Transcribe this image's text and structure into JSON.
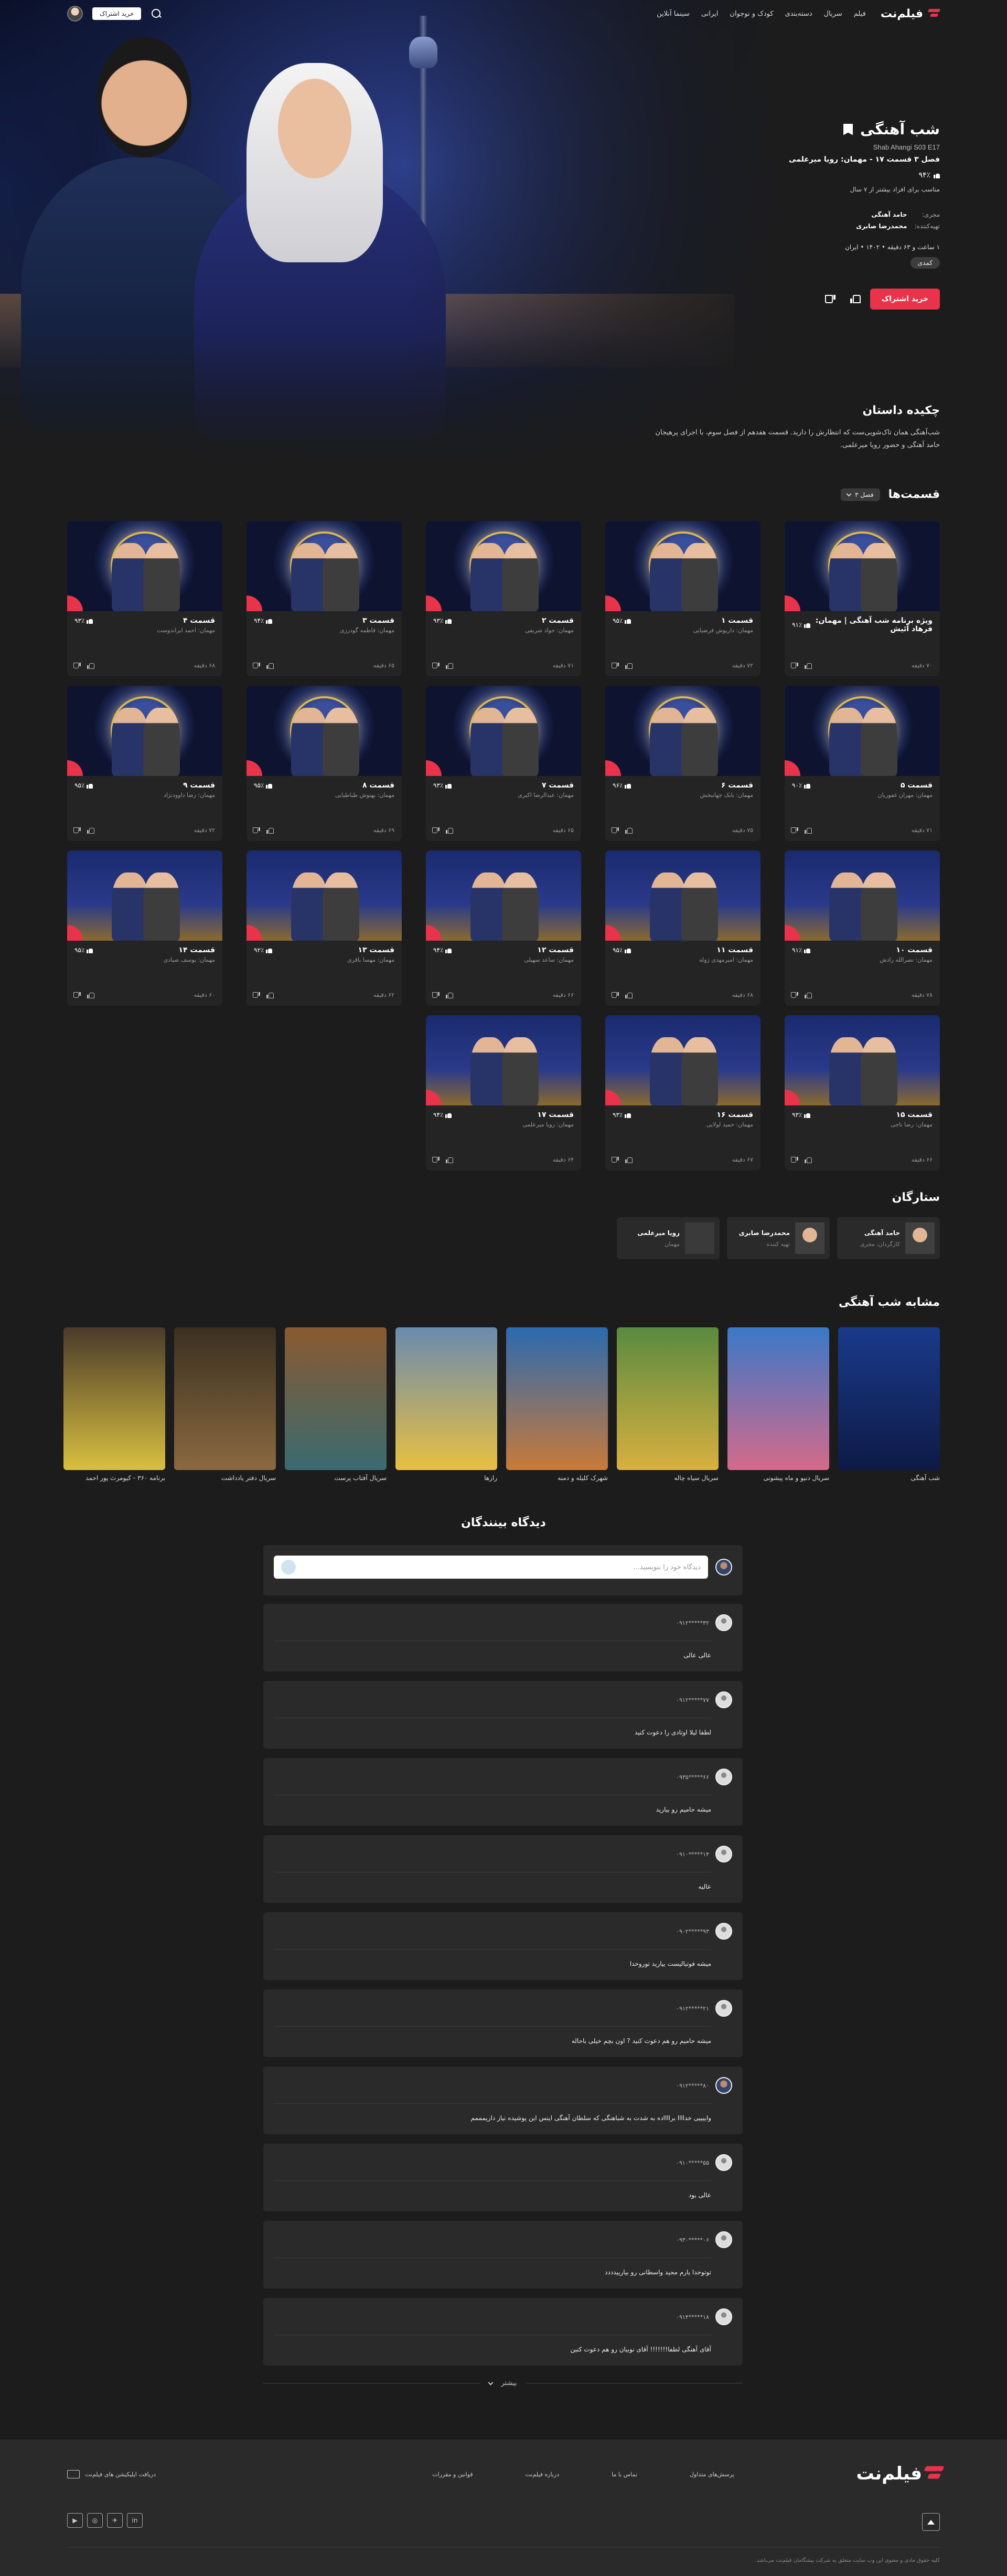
{
  "header": {
    "nav": [
      "فیلم",
      "سریال",
      "دسته‌بندی",
      "کودک و نوجوان",
      "ایرانی",
      "سینما آنلاین"
    ],
    "logo_text": "فیلم‌نت",
    "subscribe": "خرید اشتراک"
  },
  "hero": {
    "title": "شب آهنگی",
    "en_title": "Shab Ahangi S03 E17",
    "episode_title": "فصل ۳ قسمت ۱۷ - مهمان: رویا میرعلمی",
    "rating": "۹۴٪",
    "age": "مناسب برای افراد بیشتر از ۷ سال",
    "crew": [
      {
        "role": "مجری:",
        "name": "حامد آهنگی"
      },
      {
        "role": "تهیه‌کننده:",
        "name": "محمدرضا صابری"
      }
    ],
    "meta": "۱ ساعت و ۶۳ دقیقه  •  ۱۴۰۲  •  ایران",
    "genre": "کمدی",
    "subscribe_button": "خرید اشتراک"
  },
  "synopsis": {
    "title": "چکیده داستان",
    "text": "شب‌آهنگی همان تاک‌شویی‌ست که انتظارش را دارید. قسمت هفدهم از فصل سوم، با اجرای پرهیجان حامد آهنگی و حضور رویا میرعلمی."
  },
  "episodes_section": {
    "title": "قسمت‌ها",
    "season": "فصل ۳"
  },
  "episodes": [
    {
      "name": "ویژه برنامه شب آهنگی | مهمان: فرهاد آئیش",
      "guest": "",
      "rating": "۹۱٪",
      "duration": "۷۰ دقیقه",
      "city": false
    },
    {
      "name": "قسمت ۱",
      "guest": "مهمان: داریوش فرضیایی",
      "rating": "۹۵٪",
      "duration": "۷۲ دقیقه",
      "city": false
    },
    {
      "name": "قسمت ۲",
      "guest": "مهمان: جواد شریفی",
      "rating": "۹۳٪",
      "duration": "۷۱ دقیقه",
      "city": false
    },
    {
      "name": "قسمت ۳",
      "guest": "مهمان: فاطمه گودرزی",
      "rating": "۹۴٪",
      "duration": "۶۵ دقیقه",
      "city": false
    },
    {
      "name": "قسمت ۴",
      "guest": "مهمان: احمد ایراندوست",
      "rating": "۹۳٪",
      "duration": "۶۸ دقیقه",
      "city": false
    },
    {
      "name": "قسمت ۵",
      "guest": "مهمان: مهران غفوریان",
      "rating": "۹۰٪",
      "duration": "۷۱ دقیقه",
      "city": false
    },
    {
      "name": "قسمت ۶",
      "guest": "مهمان: بابک جهانبخش",
      "rating": "۹۶٪",
      "duration": "۷۵ دقیقه",
      "city": false
    },
    {
      "name": "قسمت ۷",
      "guest": "مهمان: عبدالرضا اکبری",
      "rating": "۹۳٪",
      "duration": "۶۵ دقیقه",
      "city": false
    },
    {
      "name": "قسمت ۸",
      "guest": "مهمان: بهنوش طباطبایی",
      "rating": "۹۵٪",
      "duration": "۶۹ دقیقه",
      "city": false
    },
    {
      "name": "قسمت ۹",
      "guest": "مهمان: رضا داوودنژاد",
      "rating": "۹۵٪",
      "duration": "۷۲ دقیقه",
      "city": false
    },
    {
      "name": "قسمت ۱۰",
      "guest": "مهمان: نصرالله رادش",
      "rating": "۹۱٪",
      "duration": "۷۸ دقیقه",
      "city": true
    },
    {
      "name": "قسمت ۱۱",
      "guest": "مهمان: امیرمهدی ژوله",
      "rating": "۹۵٪",
      "duration": "۶۸ دقیقه",
      "city": true
    },
    {
      "name": "قسمت ۱۲",
      "guest": "مهمان: ساعد سهیلی",
      "rating": "۹۴٪",
      "duration": "۶۶ دقیقه",
      "city": true
    },
    {
      "name": "قسمت ۱۳",
      "guest": "مهمان: مهسا باقری",
      "rating": "۹۲٪",
      "duration": "۶۲ دقیقه",
      "city": true
    },
    {
      "name": "قسمت ۱۴",
      "guest": "مهمان: یوسف صیادی",
      "rating": "۹۵٪",
      "duration": "۶۰ دقیقه",
      "city": true
    },
    {
      "name": "قسمت ۱۵",
      "guest": "مهمان: رضا ناجی",
      "rating": "۹۳٪",
      "duration": "۶۶ دقیقه",
      "city": true
    },
    {
      "name": "قسمت ۱۶",
      "guest": "مهمان: حمید لولایی",
      "rating": "۹۳٪",
      "duration": "۶۷ دقیقه",
      "city": true
    },
    {
      "name": "قسمت ۱۷",
      "guest": "مهمان: رویا میرعلمی",
      "rating": "۹۴٪",
      "duration": "۶۴ دقیقه",
      "city": true
    }
  ],
  "stars": {
    "title": "ستارگان",
    "items": [
      {
        "name": "حامد آهنگی",
        "role": "کارگردان، مجری",
        "pic": true
      },
      {
        "name": "محمدرضا صابری",
        "role": "تهیه کننده",
        "pic": true
      },
      {
        "name": "رویا میرعلمی",
        "role": "مهمان",
        "pic": false
      }
    ]
  },
  "similar": {
    "title": "مشابه شب آهنگی",
    "items": [
      {
        "name": "شب آهنگی",
        "color_top": "#1a3a8a",
        "color_bottom": "#0d1a45"
      },
      {
        "name": "سریال دنیو و ماه پیشونی",
        "color_top": "#3a78c8",
        "color_bottom": "#d46a8a"
      },
      {
        "name": "سریال سیاه چاله",
        "color_top": "#5a8a40",
        "color_bottom": "#d8b040"
      },
      {
        "name": "شهرک کلیله و دمنه",
        "color_top": "#2a6ab0",
        "color_bottom": "#c87a3a"
      },
      {
        "name": "رازها",
        "color_top": "#6a8ab0",
        "color_bottom": "#e8c040"
      },
      {
        "name": "سریال آفتاب پرست",
        "color_top": "#8a5a30",
        "color_bottom": "#3a6a70"
      },
      {
        "name": "سریال دفتر یادداشت",
        "color_top": "#3a3020",
        "color_bottom": "#8a6a40"
      },
      {
        "name": "برنامه ۳۶۰ - کیومرث پور احمد",
        "color_top": "#4a3a2a",
        "color_bottom": "#d8c040"
      }
    ]
  },
  "comments": {
    "title": "دیدگاه بینندگان",
    "placeholder": "دیدگاه خود را بنویسید...",
    "more": "بیشتر",
    "items": [
      {
        "phone": "۰۹۱۲*****۳۲",
        "text": "عالی عالی",
        "pic": false
      },
      {
        "phone": "۰۹۱۲*****۷۷",
        "text": "لطفا لیلا اوتادی را دعوت کنید",
        "pic": false
      },
      {
        "phone": "۰۹۳۵*****۶۶",
        "text": "میشه حامیم رو بیارید",
        "pic": false
      },
      {
        "phone": "۰۹۱۰*****۱۴",
        "text": "عالیه",
        "pic": false
      },
      {
        "phone": "۰۹۰۲*****۹۳",
        "text": "میشه فوتبالیست بیارید توروخدا",
        "pic": false
      },
      {
        "phone": "۰۹۱۲*****۲۱",
        "text": "میشه حامیم رو هم دعوت کنید ? اون بچم خیلی باحاله",
        "pic": false
      },
      {
        "phone": "۰۹۱۲*****۸۰",
        "text": "واییییی خداااا برااااده به شدت به شباهنگی که سلطان آهنگی اینس این پوشیده نیاز داریمممم",
        "pic": true
      },
      {
        "phone": "۰۹۱۰*****۵۵",
        "text": "عالی بود",
        "pic": false
      },
      {
        "phone": "۰۹۳۰*****۰۶",
        "text": "توتوخدا یارم مجید واسطانی رو بیارییدددد",
        "pic": false
      },
      {
        "phone": "۰۹۱۴*****۱۸",
        "text": "آقای آهنگی لطفا!!!!!!! آقای نوبیان رو هم دعوت کنین",
        "pic": false
      }
    ]
  },
  "footer": {
    "logo_text": "فیلم‌نت",
    "links": [
      "پرسش‌های متداول",
      "تماس با ما",
      "درباره فیلم‌نت",
      "قوانین و مقررات"
    ],
    "app_text": "دریافت اپلیکیشن های فیلم‌نت",
    "social": [
      "in",
      "✈",
      "◎",
      "▶"
    ],
    "copyright": "کلیه حقوق مادی و معنوی این وب سایت متعلق به شرکت پیشگامان فیلم‌نت می‌باشد."
  }
}
